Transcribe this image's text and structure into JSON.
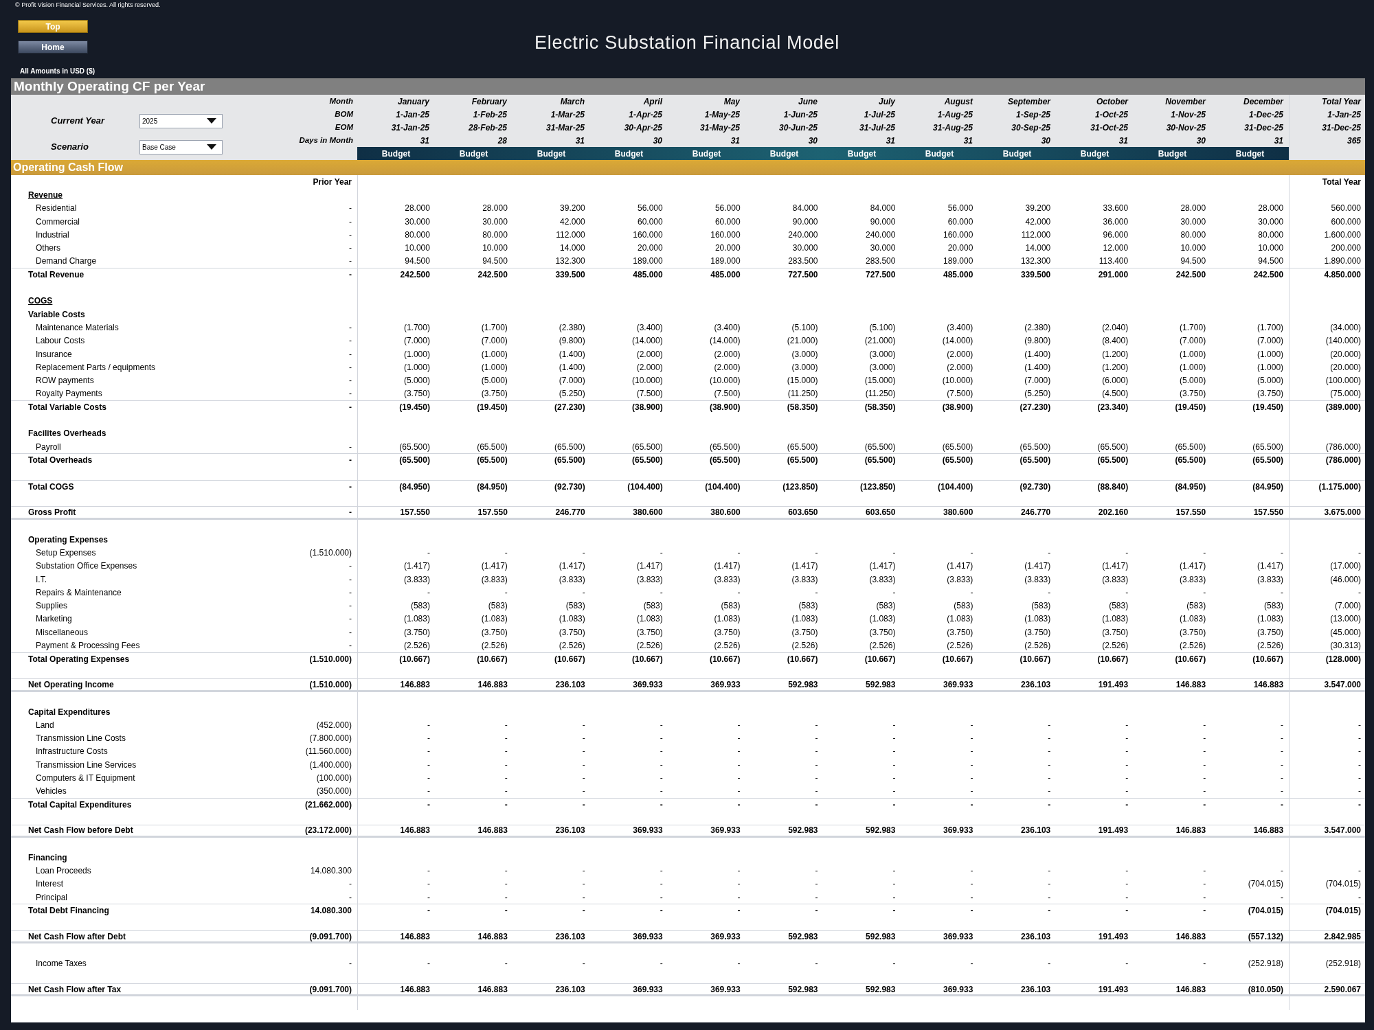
{
  "copyright": "© Profit Vision Financial Services. All rights reserved.",
  "nav_buttons": [
    {
      "label": "Top",
      "kind": "gold"
    },
    {
      "label": "Home",
      "kind": "slate"
    }
  ],
  "title": "Electric Substation Financial Model",
  "currency_note": "All Amounts in USD ($)",
  "sheet_title": "Monthly Operating CF per Year",
  "selectors": [
    {
      "label": "Current Year",
      "value": "2025"
    },
    {
      "label": "Scenario",
      "value": "Base Case"
    }
  ],
  "header_labels": [
    "Month",
    "BOM",
    "EOM",
    "Days in Month"
  ],
  "months": [
    {
      "month": "January",
      "bom": "1-Jan-25",
      "eom": "31-Jan-25",
      "days": "31",
      "scenario": "Budget"
    },
    {
      "month": "February",
      "bom": "1-Feb-25",
      "eom": "28-Feb-25",
      "days": "28",
      "scenario": "Budget"
    },
    {
      "month": "March",
      "bom": "1-Mar-25",
      "eom": "31-Mar-25",
      "days": "31",
      "scenario": "Budget"
    },
    {
      "month": "April",
      "bom": "1-Apr-25",
      "eom": "30-Apr-25",
      "days": "30",
      "scenario": "Budget"
    },
    {
      "month": "May",
      "bom": "1-May-25",
      "eom": "31-May-25",
      "days": "31",
      "scenario": "Budget"
    },
    {
      "month": "June",
      "bom": "1-Jun-25",
      "eom": "30-Jun-25",
      "days": "30",
      "scenario": "Budget"
    },
    {
      "month": "July",
      "bom": "1-Jul-25",
      "eom": "31-Jul-25",
      "days": "31",
      "scenario": "Budget"
    },
    {
      "month": "August",
      "bom": "1-Aug-25",
      "eom": "31-Aug-25",
      "days": "31",
      "scenario": "Budget"
    },
    {
      "month": "September",
      "bom": "1-Sep-25",
      "eom": "30-Sep-25",
      "days": "30",
      "scenario": "Budget"
    },
    {
      "month": "October",
      "bom": "1-Oct-25",
      "eom": "31-Oct-25",
      "days": "31",
      "scenario": "Budget"
    },
    {
      "month": "November",
      "bom": "1-Nov-25",
      "eom": "30-Nov-25",
      "days": "30",
      "scenario": "Budget"
    },
    {
      "month": "December",
      "bom": "1-Dec-25",
      "eom": "31-Dec-25",
      "days": "31",
      "scenario": "Budget"
    }
  ],
  "total_year": {
    "month": "Total Year",
    "bom": "1-Jan-25",
    "eom": "31-Dec-25",
    "days": "365"
  },
  "section_bar": "Operating Cash Flow",
  "columns": {
    "prior": "Prior Year",
    "total": "Total Year"
  },
  "rows": [
    {
      "kind": "section",
      "label": "Revenue"
    },
    {
      "kind": "item",
      "label": "Residential",
      "prior": "-",
      "values": [
        "28.000",
        "28.000",
        "39.200",
        "56.000",
        "56.000",
        "84.000",
        "84.000",
        "56.000",
        "39.200",
        "33.600",
        "28.000",
        "28.000"
      ],
      "total": "560.000"
    },
    {
      "kind": "item",
      "label": "Commercial",
      "prior": "-",
      "values": [
        "30.000",
        "30.000",
        "42.000",
        "60.000",
        "60.000",
        "90.000",
        "90.000",
        "60.000",
        "42.000",
        "36.000",
        "30.000",
        "30.000"
      ],
      "total": "600.000"
    },
    {
      "kind": "item",
      "label": "Industrial",
      "prior": "-",
      "values": [
        "80.000",
        "80.000",
        "112.000",
        "160.000",
        "160.000",
        "240.000",
        "240.000",
        "160.000",
        "112.000",
        "96.000",
        "80.000",
        "80.000"
      ],
      "total": "1.600.000"
    },
    {
      "kind": "item",
      "label": "Others",
      "prior": "-",
      "values": [
        "10.000",
        "10.000",
        "14.000",
        "20.000",
        "20.000",
        "30.000",
        "30.000",
        "20.000",
        "14.000",
        "12.000",
        "10.000",
        "10.000"
      ],
      "total": "200.000"
    },
    {
      "kind": "item",
      "label": "Demand Charge",
      "prior": "-",
      "values": [
        "94.500",
        "94.500",
        "132.300",
        "189.000",
        "189.000",
        "283.500",
        "283.500",
        "189.000",
        "132.300",
        "113.400",
        "94.500",
        "94.500"
      ],
      "total": "1.890.000"
    },
    {
      "kind": "total",
      "label": "Total Revenue",
      "prior": "-",
      "values": [
        "242.500",
        "242.500",
        "339.500",
        "485.000",
        "485.000",
        "727.500",
        "727.500",
        "485.000",
        "339.500",
        "291.000",
        "242.500",
        "242.500"
      ],
      "total": "4.850.000"
    },
    {
      "kind": "spacer"
    },
    {
      "kind": "section",
      "label": "COGS"
    },
    {
      "kind": "group",
      "label": "Variable Costs"
    },
    {
      "kind": "item",
      "label": "Maintenance Materials",
      "prior": "-",
      "values": [
        "(1.700)",
        "(1.700)",
        "(2.380)",
        "(3.400)",
        "(3.400)",
        "(5.100)",
        "(5.100)",
        "(3.400)",
        "(2.380)",
        "(2.040)",
        "(1.700)",
        "(1.700)"
      ],
      "total": "(34.000)"
    },
    {
      "kind": "item",
      "label": "Labour Costs",
      "prior": "-",
      "values": [
        "(7.000)",
        "(7.000)",
        "(9.800)",
        "(14.000)",
        "(14.000)",
        "(21.000)",
        "(21.000)",
        "(14.000)",
        "(9.800)",
        "(8.400)",
        "(7.000)",
        "(7.000)"
      ],
      "total": "(140.000)"
    },
    {
      "kind": "item",
      "label": "Insurance",
      "prior": "-",
      "values": [
        "(1.000)",
        "(1.000)",
        "(1.400)",
        "(2.000)",
        "(2.000)",
        "(3.000)",
        "(3.000)",
        "(2.000)",
        "(1.400)",
        "(1.200)",
        "(1.000)",
        "(1.000)"
      ],
      "total": "(20.000)"
    },
    {
      "kind": "item",
      "label": "Replacement Parts / equipments",
      "prior": "-",
      "values": [
        "(1.000)",
        "(1.000)",
        "(1.400)",
        "(2.000)",
        "(2.000)",
        "(3.000)",
        "(3.000)",
        "(2.000)",
        "(1.400)",
        "(1.200)",
        "(1.000)",
        "(1.000)"
      ],
      "total": "(20.000)"
    },
    {
      "kind": "item",
      "label": "ROW payments",
      "prior": "-",
      "values": [
        "(5.000)",
        "(5.000)",
        "(7.000)",
        "(10.000)",
        "(10.000)",
        "(15.000)",
        "(15.000)",
        "(10.000)",
        "(7.000)",
        "(6.000)",
        "(5.000)",
        "(5.000)"
      ],
      "total": "(100.000)"
    },
    {
      "kind": "item",
      "label": "Royalty Payments",
      "prior": "-",
      "values": [
        "(3.750)",
        "(3.750)",
        "(5.250)",
        "(7.500)",
        "(7.500)",
        "(11.250)",
        "(11.250)",
        "(7.500)",
        "(5.250)",
        "(4.500)",
        "(3.750)",
        "(3.750)"
      ],
      "total": "(75.000)"
    },
    {
      "kind": "total",
      "label": "Total Variable Costs",
      "prior": "-",
      "values": [
        "(19.450)",
        "(19.450)",
        "(27.230)",
        "(38.900)",
        "(38.900)",
        "(58.350)",
        "(58.350)",
        "(38.900)",
        "(27.230)",
        "(23.340)",
        "(19.450)",
        "(19.450)"
      ],
      "total": "(389.000)"
    },
    {
      "kind": "spacer"
    },
    {
      "kind": "group",
      "label": "Facilites Overheads"
    },
    {
      "kind": "item",
      "label": "Payroll",
      "prior": "-",
      "values": [
        "(65.500)",
        "(65.500)",
        "(65.500)",
        "(65.500)",
        "(65.500)",
        "(65.500)",
        "(65.500)",
        "(65.500)",
        "(65.500)",
        "(65.500)",
        "(65.500)",
        "(65.500)"
      ],
      "total": "(786.000)"
    },
    {
      "kind": "total",
      "label": "Total Overheads",
      "prior": "-",
      "values": [
        "(65.500)",
        "(65.500)",
        "(65.500)",
        "(65.500)",
        "(65.500)",
        "(65.500)",
        "(65.500)",
        "(65.500)",
        "(65.500)",
        "(65.500)",
        "(65.500)",
        "(65.500)"
      ],
      "total": "(786.000)"
    },
    {
      "kind": "spacer"
    },
    {
      "kind": "total",
      "label": "Total COGS",
      "prior": "-",
      "values": [
        "(84.950)",
        "(84.950)",
        "(92.730)",
        "(104.400)",
        "(104.400)",
        "(123.850)",
        "(123.850)",
        "(104.400)",
        "(92.730)",
        "(88.840)",
        "(84.950)",
        "(84.950)"
      ],
      "total": "(1.175.000)"
    },
    {
      "kind": "spacer"
    },
    {
      "kind": "net",
      "label": "Gross Profit",
      "prior": "-",
      "values": [
        "157.550",
        "157.550",
        "246.770",
        "380.600",
        "380.600",
        "603.650",
        "603.650",
        "380.600",
        "246.770",
        "202.160",
        "157.550",
        "157.550"
      ],
      "total": "3.675.000"
    },
    {
      "kind": "spacer"
    },
    {
      "kind": "group",
      "label": "Operating Expenses"
    },
    {
      "kind": "item",
      "label": "Setup Expenses",
      "prior": "(1.510.000)",
      "values": [
        "-",
        "-",
        "-",
        "-",
        "-",
        "-",
        "-",
        "-",
        "-",
        "-",
        "-",
        "-"
      ],
      "total": "-"
    },
    {
      "kind": "item",
      "label": "Substation Office Expenses",
      "prior": "-",
      "values": [
        "(1.417)",
        "(1.417)",
        "(1.417)",
        "(1.417)",
        "(1.417)",
        "(1.417)",
        "(1.417)",
        "(1.417)",
        "(1.417)",
        "(1.417)",
        "(1.417)",
        "(1.417)"
      ],
      "total": "(17.000)"
    },
    {
      "kind": "item",
      "label": "I.T.",
      "prior": "-",
      "values": [
        "(3.833)",
        "(3.833)",
        "(3.833)",
        "(3.833)",
        "(3.833)",
        "(3.833)",
        "(3.833)",
        "(3.833)",
        "(3.833)",
        "(3.833)",
        "(3.833)",
        "(3.833)"
      ],
      "total": "(46.000)"
    },
    {
      "kind": "item",
      "label": "Repairs & Maintenance",
      "prior": "-",
      "values": [
        "-",
        "-",
        "-",
        "-",
        "-",
        "-",
        "-",
        "-",
        "-",
        "-",
        "-",
        "-"
      ],
      "total": "-"
    },
    {
      "kind": "item",
      "label": "Supplies",
      "prior": "-",
      "values": [
        "(583)",
        "(583)",
        "(583)",
        "(583)",
        "(583)",
        "(583)",
        "(583)",
        "(583)",
        "(583)",
        "(583)",
        "(583)",
        "(583)"
      ],
      "total": "(7.000)"
    },
    {
      "kind": "item",
      "label": "Marketing",
      "prior": "-",
      "values": [
        "(1.083)",
        "(1.083)",
        "(1.083)",
        "(1.083)",
        "(1.083)",
        "(1.083)",
        "(1.083)",
        "(1.083)",
        "(1.083)",
        "(1.083)",
        "(1.083)",
        "(1.083)"
      ],
      "total": "(13.000)"
    },
    {
      "kind": "item",
      "label": "Miscellaneous",
      "prior": "-",
      "values": [
        "(3.750)",
        "(3.750)",
        "(3.750)",
        "(3.750)",
        "(3.750)",
        "(3.750)",
        "(3.750)",
        "(3.750)",
        "(3.750)",
        "(3.750)",
        "(3.750)",
        "(3.750)"
      ],
      "total": "(45.000)"
    },
    {
      "kind": "item",
      "label": "Payment & Processing Fees",
      "prior": "-",
      "values": [
        "(2.526)",
        "(2.526)",
        "(2.526)",
        "(2.526)",
        "(2.526)",
        "(2.526)",
        "(2.526)",
        "(2.526)",
        "(2.526)",
        "(2.526)",
        "(2.526)",
        "(2.526)"
      ],
      "total": "(30.313)"
    },
    {
      "kind": "total",
      "label": "Total Operating Expenses",
      "prior": "(1.510.000)",
      "values": [
        "(10.667)",
        "(10.667)",
        "(10.667)",
        "(10.667)",
        "(10.667)",
        "(10.667)",
        "(10.667)",
        "(10.667)",
        "(10.667)",
        "(10.667)",
        "(10.667)",
        "(10.667)"
      ],
      "total": "(128.000)"
    },
    {
      "kind": "spacer"
    },
    {
      "kind": "net",
      "label": "Net Operating Income",
      "prior": "(1.510.000)",
      "values": [
        "146.883",
        "146.883",
        "236.103",
        "369.933",
        "369.933",
        "592.983",
        "592.983",
        "369.933",
        "236.103",
        "191.493",
        "146.883",
        "146.883"
      ],
      "total": "3.547.000"
    },
    {
      "kind": "spacer"
    },
    {
      "kind": "group",
      "label": "Capital Expenditures"
    },
    {
      "kind": "item",
      "label": "Land",
      "prior": "(452.000)",
      "values": [
        "-",
        "-",
        "-",
        "-",
        "-",
        "-",
        "-",
        "-",
        "-",
        "-",
        "-",
        "-"
      ],
      "total": "-"
    },
    {
      "kind": "item",
      "label": "Transmission Line Costs",
      "prior": "(7.800.000)",
      "values": [
        "-",
        "-",
        "-",
        "-",
        "-",
        "-",
        "-",
        "-",
        "-",
        "-",
        "-",
        "-"
      ],
      "total": "-"
    },
    {
      "kind": "item",
      "label": "Infrastructure Costs",
      "prior": "(11.560.000)",
      "values": [
        "-",
        "-",
        "-",
        "-",
        "-",
        "-",
        "-",
        "-",
        "-",
        "-",
        "-",
        "-"
      ],
      "total": "-"
    },
    {
      "kind": "item",
      "label": "Transmission Line Services",
      "prior": "(1.400.000)",
      "values": [
        "-",
        "-",
        "-",
        "-",
        "-",
        "-",
        "-",
        "-",
        "-",
        "-",
        "-",
        "-"
      ],
      "total": "-"
    },
    {
      "kind": "item",
      "label": "Computers & IT Equipment",
      "prior": "(100.000)",
      "values": [
        "-",
        "-",
        "-",
        "-",
        "-",
        "-",
        "-",
        "-",
        "-",
        "-",
        "-",
        "-"
      ],
      "total": "-"
    },
    {
      "kind": "item",
      "label": "Vehicles",
      "prior": "(350.000)",
      "values": [
        "-",
        "-",
        "-",
        "-",
        "-",
        "-",
        "-",
        "-",
        "-",
        "-",
        "-",
        "-"
      ],
      "total": "-"
    },
    {
      "kind": "total",
      "label": "Total Capital Expenditures",
      "prior": "(21.662.000)",
      "values": [
        "-",
        "-",
        "-",
        "-",
        "-",
        "-",
        "-",
        "-",
        "-",
        "-",
        "-",
        "-"
      ],
      "total": "-"
    },
    {
      "kind": "spacer"
    },
    {
      "kind": "net",
      "label": "Net Cash Flow before Debt",
      "prior": "(23.172.000)",
      "values": [
        "146.883",
        "146.883",
        "236.103",
        "369.933",
        "369.933",
        "592.983",
        "592.983",
        "369.933",
        "236.103",
        "191.493",
        "146.883",
        "146.883"
      ],
      "total": "3.547.000"
    },
    {
      "kind": "spacer"
    },
    {
      "kind": "group",
      "label": "Financing"
    },
    {
      "kind": "item",
      "label": "Loan Proceeds",
      "prior": "14.080.300",
      "values": [
        "-",
        "-",
        "-",
        "-",
        "-",
        "-",
        "-",
        "-",
        "-",
        "-",
        "-",
        "-"
      ],
      "total": "-"
    },
    {
      "kind": "item",
      "label": "Interest",
      "prior": "-",
      "values": [
        "-",
        "-",
        "-",
        "-",
        "-",
        "-",
        "-",
        "-",
        "-",
        "-",
        "-",
        "(704.015)"
      ],
      "total": "(704.015)"
    },
    {
      "kind": "item",
      "label": "Principal",
      "prior": "-",
      "values": [
        "-",
        "-",
        "-",
        "-",
        "-",
        "-",
        "-",
        "-",
        "-",
        "-",
        "-",
        "-"
      ],
      "total": "-"
    },
    {
      "kind": "total",
      "label": "Total Debt Financing",
      "prior": "14.080.300",
      "values": [
        "-",
        "-",
        "-",
        "-",
        "-",
        "-",
        "-",
        "-",
        "-",
        "-",
        "-",
        "(704.015)"
      ],
      "total": "(704.015)"
    },
    {
      "kind": "spacer"
    },
    {
      "kind": "net",
      "label": "Net Cash Flow after Debt",
      "prior": "(9.091.700)",
      "values": [
        "146.883",
        "146.883",
        "236.103",
        "369.933",
        "369.933",
        "592.983",
        "592.983",
        "369.933",
        "236.103",
        "191.493",
        "146.883",
        "(557.132)"
      ],
      "total": "2.842.985"
    },
    {
      "kind": "spacer"
    },
    {
      "kind": "item",
      "label": "Income Taxes",
      "prior": "-",
      "values": [
        "-",
        "-",
        "-",
        "-",
        "-",
        "-",
        "-",
        "-",
        "-",
        "-",
        "-",
        "(252.918)"
      ],
      "total": "(252.918)"
    },
    {
      "kind": "spacer"
    },
    {
      "kind": "net",
      "label": "Net Cash Flow after Tax",
      "prior": "(9.091.700)",
      "values": [
        "146.883",
        "146.883",
        "236.103",
        "369.933",
        "369.933",
        "592.983",
        "592.983",
        "369.933",
        "236.103",
        "191.493",
        "146.883",
        "(810.050)"
      ],
      "total": "2.590.067"
    },
    {
      "kind": "spacer"
    }
  ]
}
